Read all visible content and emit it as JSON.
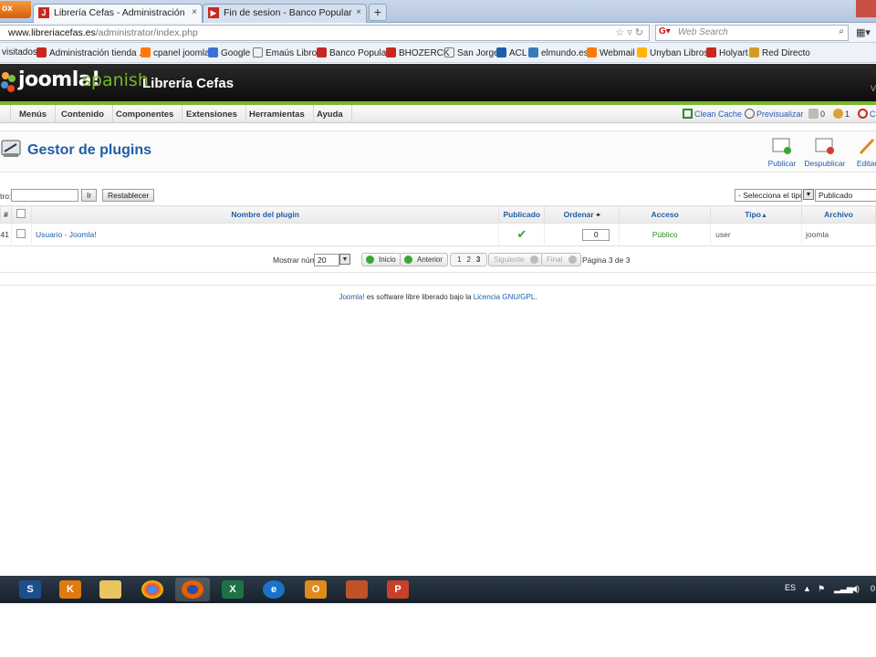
{
  "browser": {
    "firefox_button": "ox",
    "tabs": [
      {
        "title": "Librería Cefas - Administración",
        "active": true
      },
      {
        "title": "Fin de sesion - Banco Popular",
        "active": false
      }
    ],
    "new_tab": "+",
    "tab_close": "×",
    "url_host": "www.libreriacefas.es",
    "url_path": "/administrator/index.php",
    "search_placeholder": "Web Search",
    "bookmarks": [
      {
        "label": "visitados",
        "color": "#ffffff"
      },
      {
        "label": "Administración tienda ...",
        "color": "#c8281e"
      },
      {
        "label": "cpanel joomla",
        "color": "#ff7a00"
      },
      {
        "label": "Google",
        "color": "#3d6fd8"
      },
      {
        "label": "Emaús Libros",
        "color": "#ffffff"
      },
      {
        "label": "Banco Popular",
        "color": "#c8281e"
      },
      {
        "label": "BHOZERCK",
        "color": "#c8281e"
      },
      {
        "label": "San Jorge",
        "color": "#ffffff"
      },
      {
        "label": "ACL",
        "color": "#1f5ea8"
      },
      {
        "label": "elmundo.es",
        "color": "#3a7ab8"
      },
      {
        "label": "Webmail",
        "color": "#ff7a00"
      },
      {
        "label": "Unyban Libros",
        "color": "#ffb400"
      },
      {
        "label": "Holyart",
        "color": "#c8281e"
      },
      {
        "label": "Red Directo",
        "color": "#d99a20"
      }
    ]
  },
  "joomla": {
    "brand": "joomla!",
    "brand_suffix": "spanish",
    "site_name": "Librería Cefas",
    "version_letter": "V",
    "menu": [
      "Menús",
      "Contenido",
      "Componentes",
      "Extensiones",
      "Herramientas",
      "Ayuda"
    ],
    "menu_right": {
      "clean_cache": "Clean Cache",
      "preview": "Previsualizar",
      "messages": "0",
      "users": "1",
      "logout": "C"
    }
  },
  "toolbar": {
    "title": "Gestor de plugins",
    "buttons": [
      "Publicar",
      "Despublicar",
      "Editar"
    ]
  },
  "filter": {
    "label": "tro:",
    "input_value": "",
    "go_button": "Ir",
    "reset_button": "Restablecer",
    "type_select": "- Selecciona el tipo -",
    "state_select": "Publicado"
  },
  "table": {
    "headers": {
      "num": "#",
      "name": "Nombre del plugin",
      "published": "Publicado",
      "order": "Ordenar",
      "access": "Acceso",
      "type": "Tipo",
      "file": "Archivo"
    },
    "rows": [
      {
        "num": "41",
        "name": "Usuario - Joomla!",
        "order": "0",
        "access": "Público",
        "type": "user",
        "file": "joomla"
      }
    ]
  },
  "pagination": {
    "show_label": "Mostrar núm.",
    "limit": "20",
    "start": "Inicio",
    "prev": "Anterior",
    "pages": [
      "1",
      "2",
      "3"
    ],
    "next": "Siguiente",
    "end": "Final",
    "page_info": "Página 3 de 3"
  },
  "footer": {
    "link1": "Joomla!",
    "text": " es software libre liberado bajo la ",
    "link2": "Licencia GNU/GPL",
    "end": "."
  },
  "taskbar": {
    "apps": [
      "sitemaker-icon",
      "kt-icon",
      "explorer-icon",
      "chrome-icon",
      "firefox-icon",
      "excel-icon",
      "ie-icon",
      "outlook-icon",
      "book-icon",
      "powerpoint-icon"
    ],
    "lang": "ES",
    "clock": "0"
  }
}
